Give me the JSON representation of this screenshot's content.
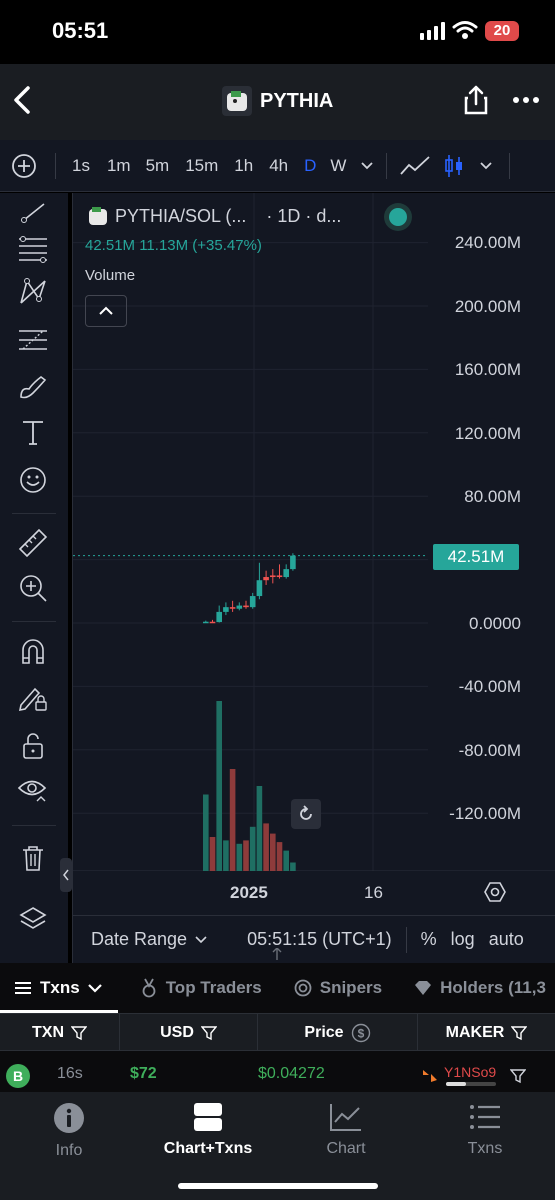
{
  "status": {
    "time": "05:51",
    "battery": "20"
  },
  "header": {
    "title": "PYTHIA"
  },
  "toolbar": {
    "timeframes": [
      "1s",
      "1m",
      "5m",
      "15m",
      "1h",
      "4h",
      "D",
      "W"
    ],
    "active_timeframe": "D"
  },
  "chart": {
    "symbol": "PYTHIA/SOL (...",
    "interval": "· 1D · d...",
    "legend_values": "42.51M  11.13M (+35.47%)",
    "volume_label": "Volume",
    "y_ticks": [
      "240.00M",
      "200.00M",
      "160.00M",
      "120.00M",
      "80.00M",
      "0.0000",
      "-40.00M",
      "-80.00M",
      "-120.00M"
    ],
    "last_price": "42.51M",
    "x_ticks": [
      "2025",
      "16"
    ],
    "bottom_bar": {
      "date_range": "Date Range",
      "clock": "05:51:15 (UTC+1)",
      "percent": "%",
      "log": "log",
      "auto": "auto"
    }
  },
  "chart_data": {
    "type": "candlestick",
    "ylim": [
      -160,
      260
    ],
    "y_unit": "M",
    "candles": [
      {
        "o": 0.3,
        "h": 1.5,
        "l": 0,
        "c": 0.8,
        "up": true
      },
      {
        "o": 0.8,
        "h": 2.0,
        "l": 0.2,
        "c": 0.6,
        "up": false
      },
      {
        "o": 0.6,
        "h": 11,
        "l": 0.3,
        "c": 7,
        "up": true
      },
      {
        "o": 7,
        "h": 13,
        "l": 5,
        "c": 10,
        "up": true
      },
      {
        "o": 10,
        "h": 14,
        "l": 7,
        "c": 9,
        "up": false
      },
      {
        "o": 9,
        "h": 13,
        "l": 8,
        "c": 11,
        "up": true
      },
      {
        "o": 11,
        "h": 14,
        "l": 9,
        "c": 10,
        "up": false
      },
      {
        "o": 10,
        "h": 19,
        "l": 9,
        "c": 17,
        "up": true
      },
      {
        "o": 17,
        "h": 38,
        "l": 15,
        "c": 27,
        "up": true
      },
      {
        "o": 27,
        "h": 33,
        "l": 24,
        "c": 29,
        "up": false
      },
      {
        "o": 29,
        "h": 34,
        "l": 25,
        "c": 30,
        "up": false
      },
      {
        "o": 30,
        "h": 37,
        "l": 28,
        "c": 29,
        "up": false
      },
      {
        "o": 29,
        "h": 37,
        "l": 28,
        "c": 34,
        "up": true
      },
      {
        "o": 34,
        "h": 44,
        "l": 33,
        "c": 42.51,
        "up": true
      }
    ],
    "volume_relative": [
      0.45,
      0.2,
      1.0,
      0.18,
      0.6,
      0.16,
      0.18,
      0.26,
      0.5,
      0.28,
      0.22,
      0.17,
      0.12,
      0.05
    ]
  },
  "tabs": [
    {
      "label": "Txns",
      "active": true
    },
    {
      "label": "Top Traders"
    },
    {
      "label": "Snipers"
    },
    {
      "label": "Holders (11,3"
    }
  ],
  "table": {
    "columns": [
      "TXN",
      "USD",
      "Price",
      "MAKER"
    ],
    "rows": [
      {
        "type": "B",
        "age": "16s",
        "usd": "$72",
        "price": "$0.04272",
        "maker": "Y1NSo9"
      }
    ]
  },
  "nav": [
    {
      "label": "Info",
      "icon": "info-icon"
    },
    {
      "label": "Chart+Txns",
      "icon": "split-view-icon",
      "active": true
    },
    {
      "label": "Chart",
      "icon": "chart-icon"
    },
    {
      "label": "Txns",
      "icon": "list-icon"
    }
  ],
  "colors": {
    "up": "#26a69a",
    "down": "#ef5350",
    "accent": "#2962ff",
    "buy": "#3fae5b"
  }
}
